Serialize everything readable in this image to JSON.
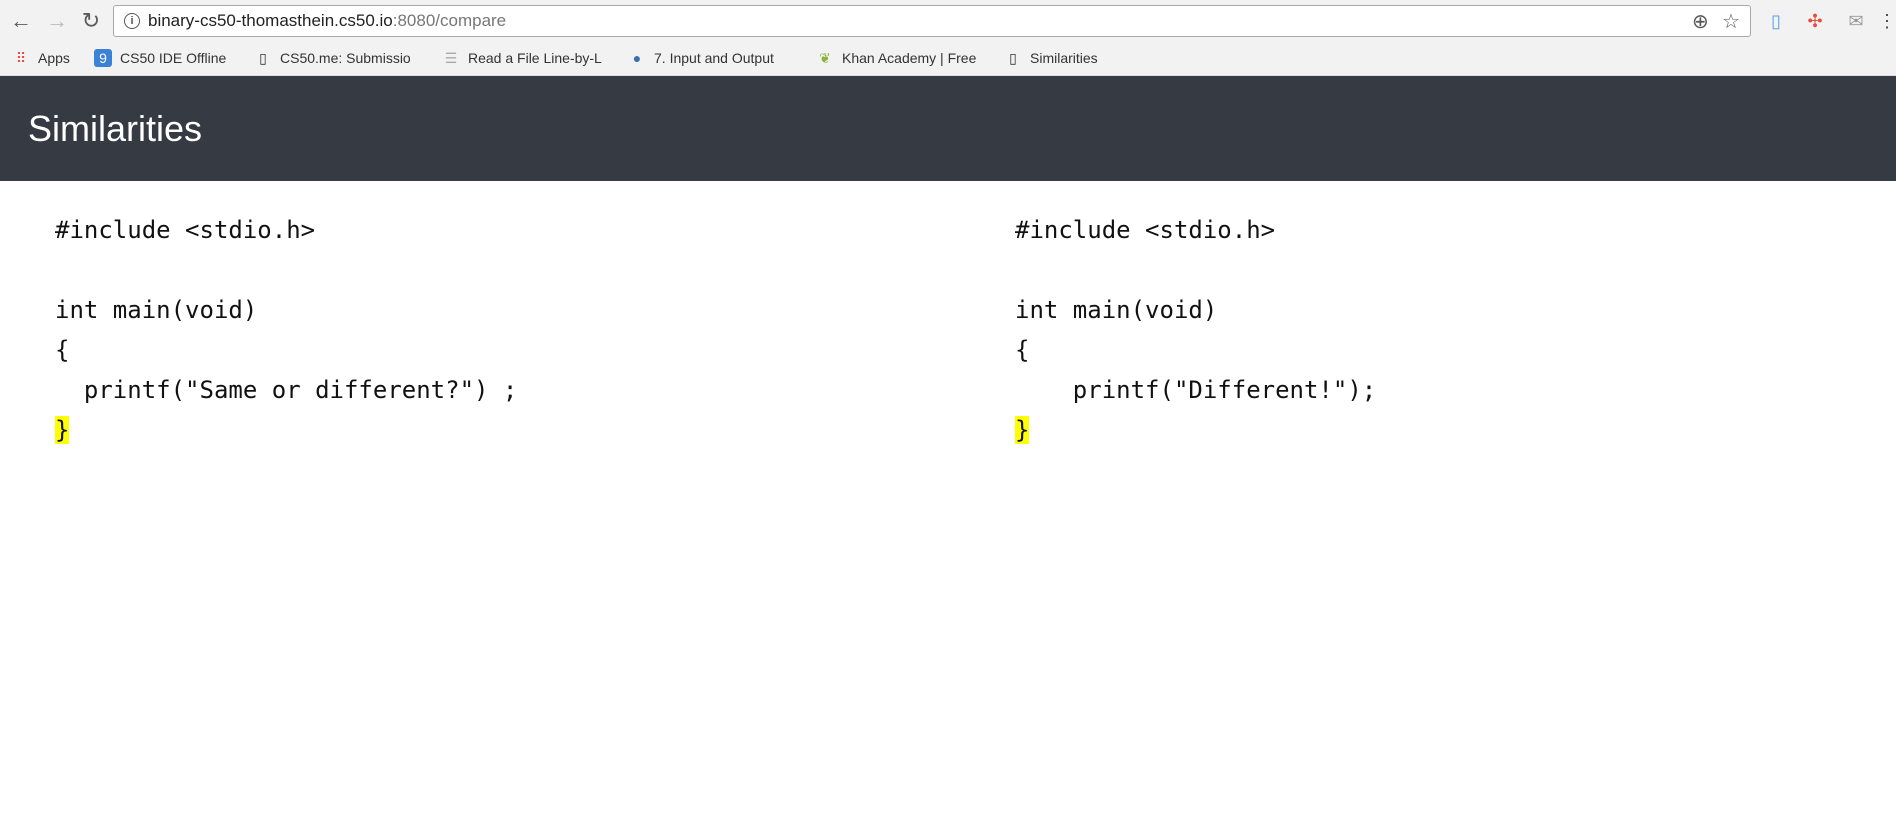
{
  "browser": {
    "url_host": "binary-cs50-thomasthein.cs50.io",
    "url_rest": ":8080/compare",
    "bookmarks": [
      {
        "label": "Apps",
        "icon": "apps-grid-icon"
      },
      {
        "label": "CS50 IDE Offline",
        "icon": "cs50-ide-icon"
      },
      {
        "label": "CS50.me: Submissio",
        "icon": "page-icon"
      },
      {
        "label": "Read a File Line-by-L",
        "icon": "list-icon"
      },
      {
        "label": "7. Input and Output",
        "icon": "python-icon"
      },
      {
        "label": "Khan Academy | Free",
        "icon": "leaf-icon"
      },
      {
        "label": "Similarities",
        "icon": "page-icon"
      }
    ]
  },
  "header": {
    "title": "Similarities"
  },
  "left_file": {
    "lines": [
      "#include <stdio.h>",
      "",
      "int main(void)",
      "{",
      "  printf(\"Same or different?\") ;"
    ],
    "highlighted_line": "}"
  },
  "right_file": {
    "lines": [
      "#include <stdio.h>",
      "",
      "int main(void)",
      "{",
      "    printf(\"Different!\");"
    ],
    "highlighted_line": "}"
  },
  "colors": {
    "header_bg": "#363a42",
    "highlight": "#ffff00"
  }
}
